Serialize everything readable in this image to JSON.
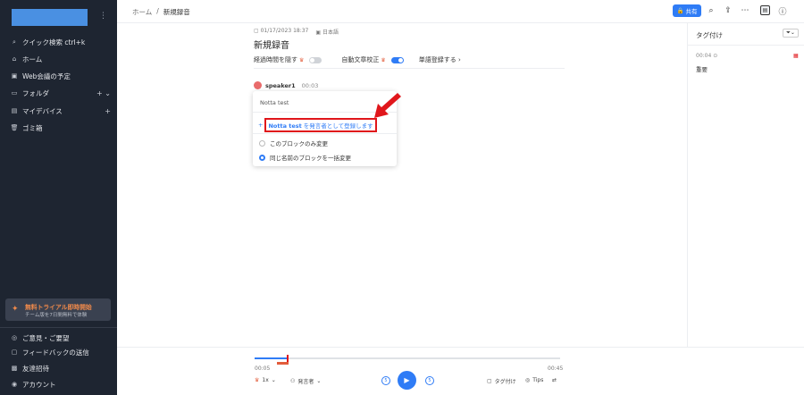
{
  "sidebar": {
    "items": [
      {
        "label": "クイック検索 ctrl+k",
        "icon": "search-icon"
      },
      {
        "label": "ホーム",
        "icon": "home-icon"
      },
      {
        "label": "Web会議の予定",
        "icon": "calendar-icon"
      },
      {
        "label": "フォルダ",
        "icon": "folder-icon"
      },
      {
        "label": "マイデバイス",
        "icon": "device-icon"
      },
      {
        "label": "ゴミ箱",
        "icon": "trash-icon"
      }
    ],
    "trial": {
      "title": "無料トライアル即時開始",
      "subtitle": "チーム版を7日間無料で体験"
    },
    "bottom_items": [
      {
        "label": "ご意見・ご要望",
        "icon": "lightbulb-icon"
      },
      {
        "label": "フィードバックの送信",
        "icon": "feedback-icon"
      },
      {
        "label": "友達招待",
        "icon": "gift-icon"
      },
      {
        "label": "アカウント",
        "icon": "user-icon"
      }
    ]
  },
  "header": {
    "breadcrumb_home": "ホーム",
    "breadcrumb_sep": "/",
    "breadcrumb_current": "新規録音",
    "share_label": "共有"
  },
  "recording": {
    "date": "01/17/2023 18:37",
    "language": "日本語",
    "title": "新規録音",
    "option_elapsed": "経過時間を隠す",
    "option_autocorrect": "自動文章校正",
    "option_dictionary": "単語登録する",
    "speaker_name": "speaker1",
    "speaker_time": "00:03"
  },
  "popup": {
    "input_value": "Notta test",
    "add_name": "Notta test",
    "add_suffix": "を発言者として登録します",
    "radio_block_only": "このブロックのみ変更",
    "radio_all_blocks": "同じ名前のブロックを一括変更"
  },
  "right_panel": {
    "title": "タグ付け",
    "tag_time": "00:04",
    "tag_label": "重要"
  },
  "player": {
    "time_current": "00:05",
    "time_total": "00:45",
    "progress_fraction": 0.11,
    "speed": "1x",
    "speaker_filter": "発言者",
    "tag_label": "タグ付け",
    "tips_label": "Tips",
    "skip_back": "5",
    "skip_forward": "5"
  },
  "colors": {
    "sidebar_bg": "#1e2531",
    "accent": "#2f7cf6",
    "highlight_red": "#e0161b"
  }
}
